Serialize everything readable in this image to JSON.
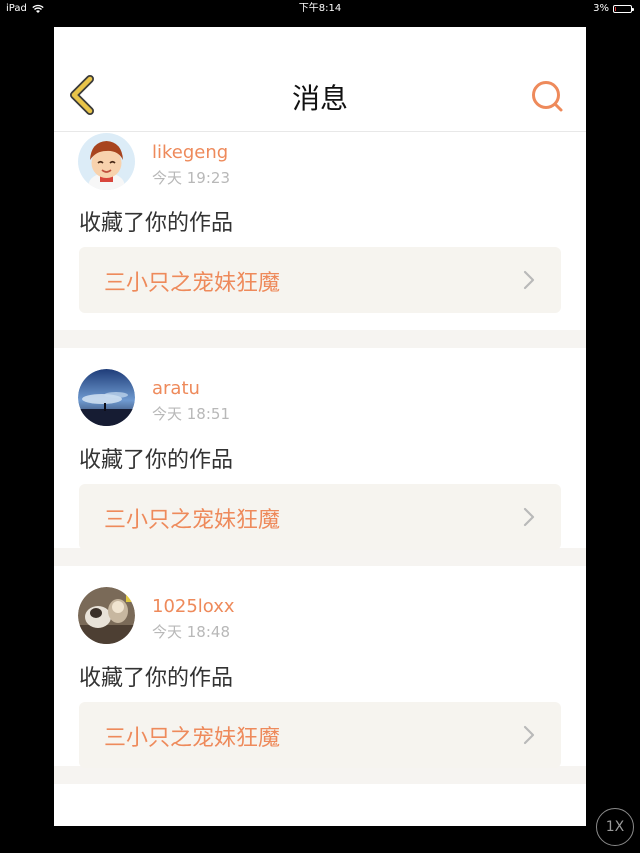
{
  "statusbar": {
    "device": "iPad",
    "time": "下午8:14",
    "battery": "3%",
    "battery_level": 0.03
  },
  "navbar": {
    "title": "消息",
    "back_icon": "chevron-left-icon",
    "search_icon": "search-icon"
  },
  "colors": {
    "accent": "#ee8a5b",
    "back_icon": "#e8c44a",
    "work_box_bg": "#f6f4ef",
    "divider": "#f6f4f1"
  },
  "messages": [
    {
      "username": "likegeng",
      "time": "今天 19:23",
      "action": "收藏了你的作品",
      "work_title": "三小只之宠妹狂魔"
    },
    {
      "username": "aratu",
      "time": "今天 18:51",
      "action": "收藏了你的作品",
      "work_title": "三小只之宠妹狂魔"
    },
    {
      "username": "1025loxx",
      "time": "今天 18:48",
      "action": "收藏了你的作品",
      "work_title": "三小只之宠妹狂魔"
    }
  ],
  "zoom": "1X"
}
